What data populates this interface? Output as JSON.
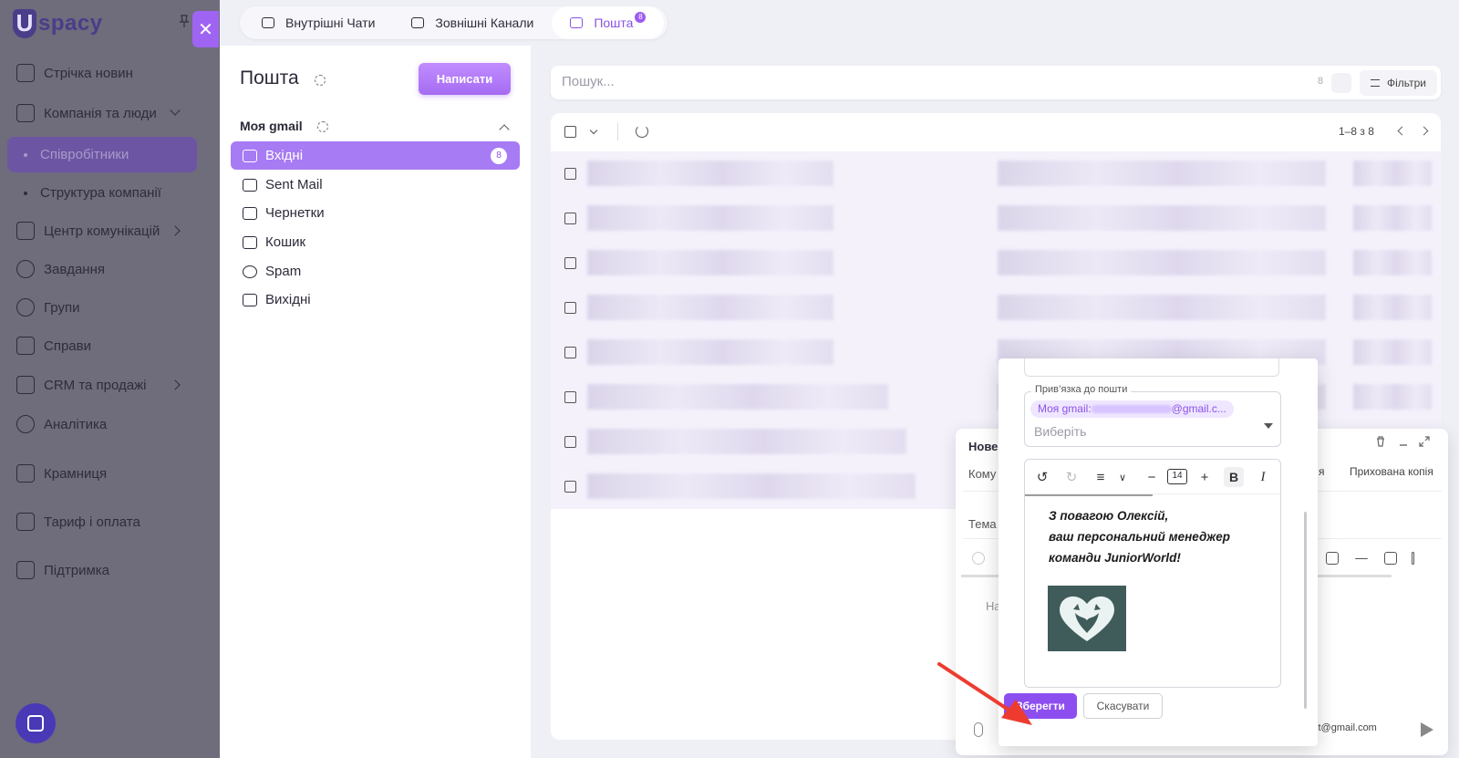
{
  "app": {
    "brand": "spacy",
    "brand_mark": "U",
    "close_symbol": "✕"
  },
  "sidebar": {
    "items": [
      {
        "label": "Стрічка новин",
        "icon": "news-feed-icon"
      },
      {
        "label": "Компанія та люди",
        "icon": "company-icon"
      },
      {
        "label": "Співробітники",
        "icon": "dot"
      },
      {
        "label": "Структура компанії",
        "icon": "dot"
      },
      {
        "label": "Центр комунікацій",
        "icon": "communications-icon"
      },
      {
        "label": "Завдання",
        "icon": "tasks-icon"
      },
      {
        "label": "Групи",
        "icon": "groups-icon"
      },
      {
        "label": "Справи",
        "icon": "calendar-icon"
      },
      {
        "label": "CRM та продажі",
        "icon": "crm-icon"
      },
      {
        "label": "Аналітика",
        "icon": "analytics-icon"
      },
      {
        "label": "Крамниця",
        "icon": "store-icon"
      },
      {
        "label": "Тариф і оплата",
        "icon": "billing-icon"
      },
      {
        "label": "Підтримка",
        "icon": "support-icon"
      }
    ]
  },
  "topbar": {
    "tabs": [
      {
        "label": "Внутрішні Чати",
        "icon": "chat-icon"
      },
      {
        "label": "Зовнішні Канали",
        "icon": "channels-icon"
      },
      {
        "label": "Пошта",
        "icon": "mail-icon",
        "badge": "8",
        "active": true
      }
    ]
  },
  "mail": {
    "title": "Пошта",
    "compose_label": "Написати",
    "account": "Моя gmail",
    "folders": [
      {
        "label": "Вхідні",
        "icon": "inbox-icon",
        "badge": "8",
        "active": true
      },
      {
        "label": "Sent Mail",
        "icon": "send-icon"
      },
      {
        "label": "Чернетки",
        "icon": "drafts-icon"
      },
      {
        "label": "Кошик",
        "icon": "trash-icon"
      },
      {
        "label": "Spam",
        "icon": "spam-icon"
      },
      {
        "label": "Вихідні",
        "icon": "outbox-icon"
      }
    ]
  },
  "search": {
    "placeholder": "Пошук...",
    "count": "8",
    "filters_label": "Фільтри"
  },
  "list": {
    "pager": "1–8 з 8"
  },
  "compose": {
    "title": "Нове",
    "to_label": "Кому",
    "subject_label": "Тема",
    "cc_label": "я",
    "bcc_label": "Прихована копія",
    "body_placeholder": "На",
    "from_value": "st@gmail.com"
  },
  "signature_modal": {
    "binding_label": "Прив’язка до пошти",
    "binding_chip_prefix": "Моя gmail:",
    "binding_chip_suffix": "@gmail.c...",
    "binding_select_placeholder": "Виберіть",
    "font_size": "14",
    "signature_text": "З повагою Олексій,\nваш персональний менеджер\nкоманди JuniorWorld!",
    "save_label": "Зберегти",
    "cancel_label": "Скасувати"
  },
  "colors": {
    "accent": "#8d4ef0",
    "sidebar_overlay": "#6f6c7c",
    "active_folder": "#a77bf3",
    "annotation_arrow": "#ee3b2f"
  }
}
